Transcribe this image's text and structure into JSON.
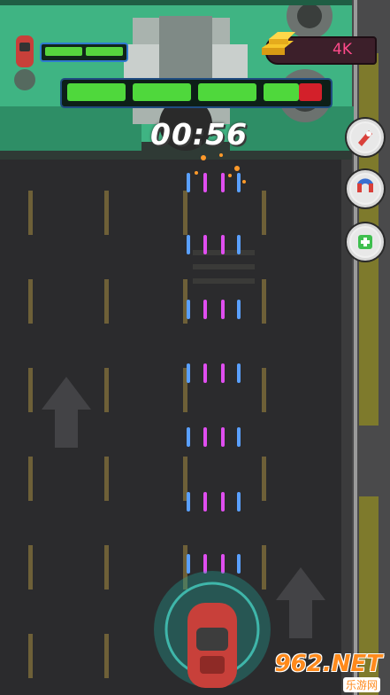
{
  "hud": {
    "timer": "00:56",
    "gold": "4K",
    "player_health": {
      "segments_total": 2,
      "segments_full": 2
    },
    "boss_health": {
      "segments_total": 4,
      "segments_full": 3,
      "last_segment_fill": 0.6
    }
  },
  "powerups": [
    {
      "name": "rocket-powerup",
      "icon": "rocket-icon",
      "color": "#d9403a"
    },
    {
      "name": "magnet-powerup",
      "icon": "magnet-icon",
      "color": "#3a6fd0"
    },
    {
      "name": "repair-powerup",
      "icon": "wrench-plus-icon",
      "color": "#3fbf4f"
    }
  ],
  "watermark": {
    "main": "962.NET",
    "sub": "乐游网"
  },
  "colors": {
    "road": "#2b2b2d",
    "boss": "#3fb483",
    "player_car": "#c8403a",
    "bullet_pink": "#e04ef0",
    "bullet_blue": "#5aa0ff"
  }
}
